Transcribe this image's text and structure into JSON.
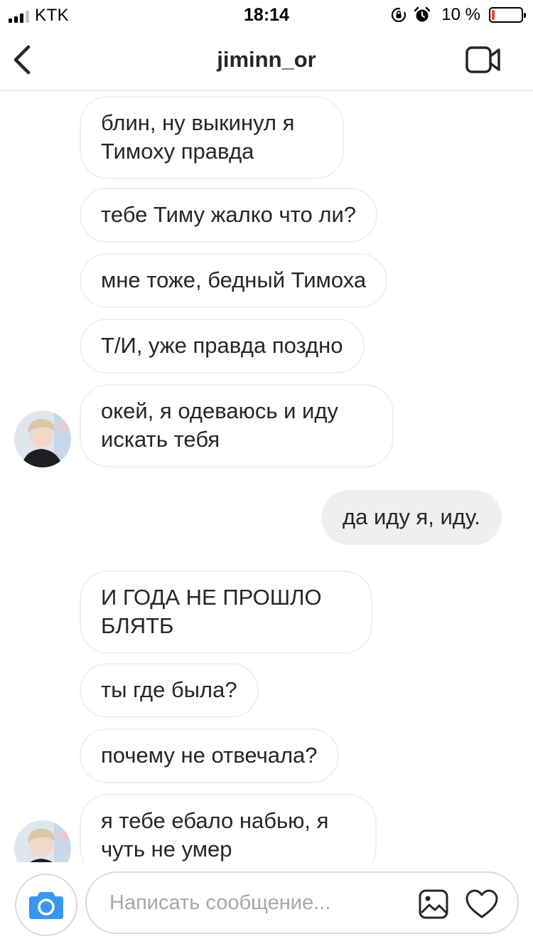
{
  "status_bar": {
    "carrier": "KTK",
    "time": "18:14",
    "battery_percent": "10 %",
    "battery_level": 0.1,
    "battery_color": "#ff3b30"
  },
  "header": {
    "title": "jiminn_or",
    "back_icon": "chevron-left-icon",
    "video_icon": "video-camera-icon"
  },
  "messages": [
    {
      "sender": "other",
      "text": "блин, ну выкинул я\nТимоху правда"
    },
    {
      "sender": "other",
      "text": "тебе Тиму жалко что ли?"
    },
    {
      "sender": "other",
      "text": "мне тоже, бедный Тимоха"
    },
    {
      "sender": "other",
      "text": "Т/И, уже правда поздно"
    },
    {
      "sender": "other",
      "text": "окей, я одеваюсь и иду\nискать тебя",
      "avatar": true
    },
    {
      "sender": "me",
      "text": "да иду я, иду."
    },
    {
      "sender": "other",
      "text": "И ГОДА НЕ ПРОШЛО\nБЛЯТБ"
    },
    {
      "sender": "other",
      "text": "ты где была?"
    },
    {
      "sender": "other",
      "text": "почему не отвечала?"
    },
    {
      "sender": "other",
      "text": "я тебе ебало набью, я\nчуть не умер",
      "avatar": true
    }
  ],
  "composer": {
    "placeholder": "Написать сообщение...",
    "camera_icon": "camera-icon",
    "gallery_icon": "gallery-icon",
    "heart_icon": "heart-icon",
    "camera_color": "#3897f0"
  }
}
